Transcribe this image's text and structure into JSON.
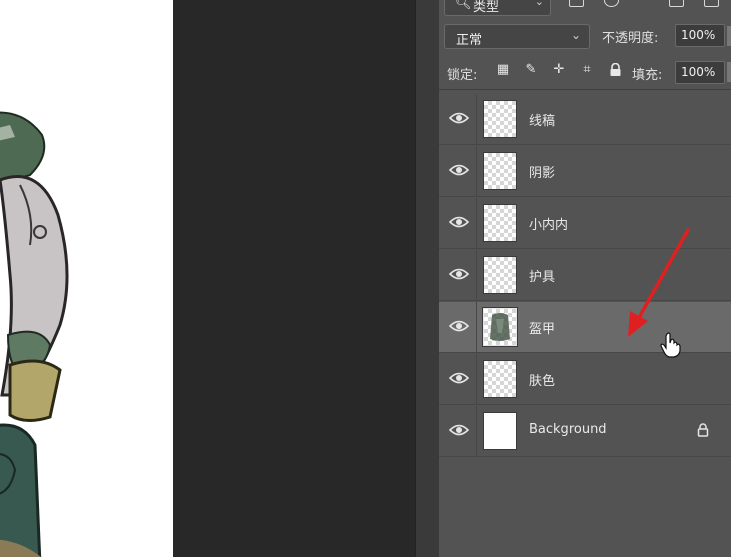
{
  "panel": {
    "filter_kind": "类型",
    "blend_mode": "正常",
    "opacity_label": "不透明度:",
    "opacity_value": "100%",
    "lock_label": "锁定:",
    "fill_label": "填充:",
    "fill_value": "100%"
  },
  "layers": [
    {
      "name": "线稿",
      "visible": true,
      "selected": false,
      "locked": false
    },
    {
      "name": "阴影",
      "visible": true,
      "selected": false,
      "locked": false
    },
    {
      "name": "小内内",
      "visible": true,
      "selected": false,
      "locked": false
    },
    {
      "name": "护具",
      "visible": true,
      "selected": false,
      "locked": false
    },
    {
      "name": "盔甲",
      "visible": true,
      "selected": true,
      "locked": false
    },
    {
      "name": "肤色",
      "visible": true,
      "selected": false,
      "locked": false
    },
    {
      "name": "Background",
      "visible": true,
      "selected": false,
      "locked": true
    }
  ],
  "colors": {
    "panel_bg": "#535353",
    "selected_row": "#6a6a6a",
    "annotation_arrow": "#e02020"
  }
}
